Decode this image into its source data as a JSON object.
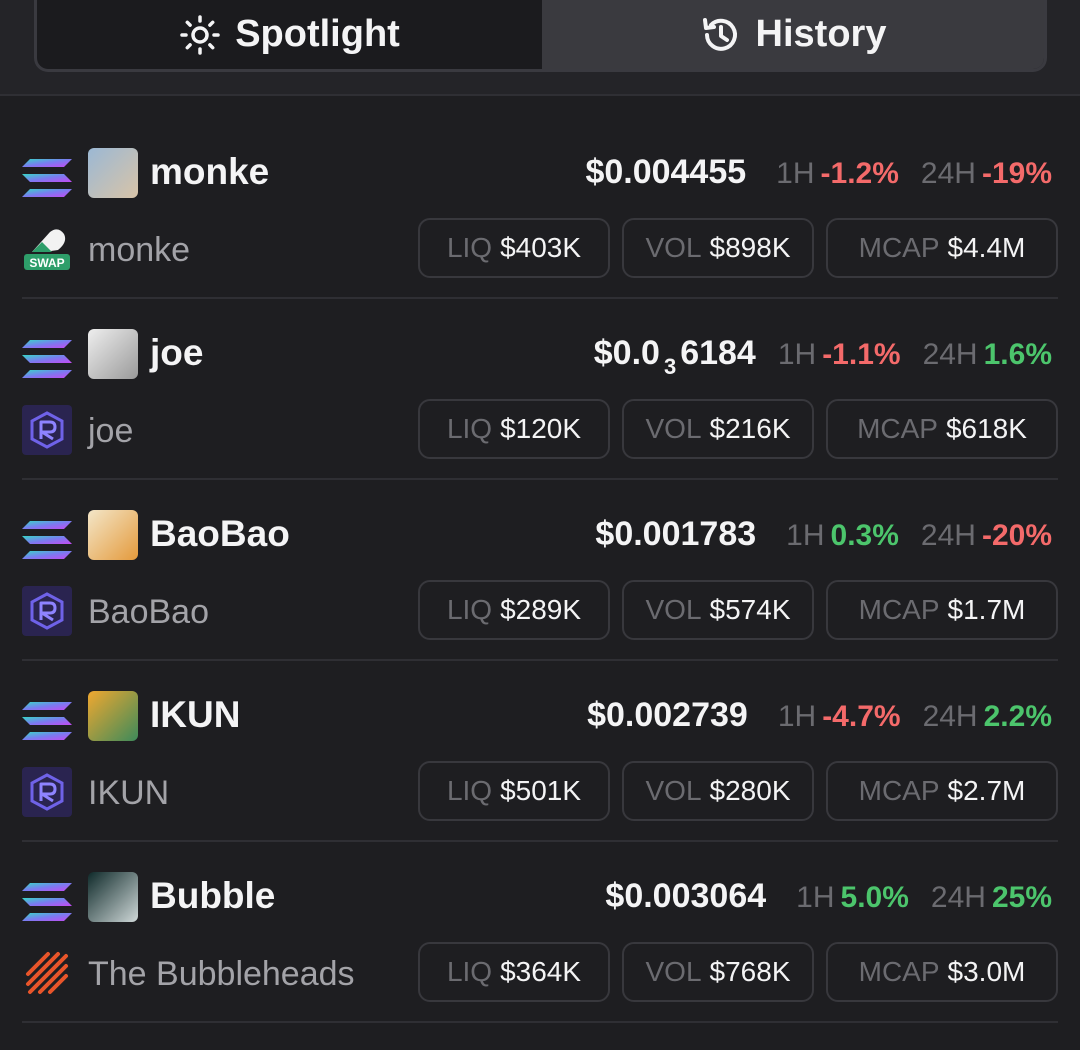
{
  "tabs": [
    {
      "label": "Spotlight",
      "icon": "sun-icon",
      "active": true
    },
    {
      "label": "History",
      "icon": "history-icon",
      "active": false
    }
  ],
  "labels": {
    "h1": "1H",
    "h24": "24H",
    "liq": "LIQ",
    "vol": "VOL",
    "mcap": "MCAP"
  },
  "colors": {
    "negative": "#f46a6a",
    "positive": "#4cc56c",
    "background": "#1e1e21"
  },
  "tokens": [
    {
      "ticker": "monke",
      "name": "monke",
      "dex_icon": "swap-icon",
      "price_prefix": "$0.004455",
      "price_sub": "",
      "price_suffix": "",
      "change_1h": "-1.2%",
      "change_1h_dir": "neg",
      "change_24h": "-19%",
      "change_24h_dir": "neg",
      "liq": "$403K",
      "vol": "$898K",
      "mcap": "$4.4M",
      "avatar_colors": [
        "#9bb8d4",
        "#d8c4a8"
      ]
    },
    {
      "ticker": "joe",
      "name": "joe",
      "dex_icon": "raydium-icon",
      "price_prefix": "$0.0",
      "price_sub": "3",
      "price_suffix": "6184",
      "change_1h": "-1.1%",
      "change_1h_dir": "neg",
      "change_24h": "1.6%",
      "change_24h_dir": "pos",
      "liq": "$120K",
      "vol": "$216K",
      "mcap": "$618K",
      "avatar_colors": [
        "#eeeeee",
        "#9a9a9a"
      ]
    },
    {
      "ticker": "BaoBao",
      "name": "BaoBao",
      "dex_icon": "raydium-icon",
      "price_prefix": "$0.001783",
      "price_sub": "",
      "price_suffix": "",
      "change_1h": "0.3%",
      "change_1h_dir": "pos",
      "change_24h": "-20%",
      "change_24h_dir": "neg",
      "liq": "$289K",
      "vol": "$574K",
      "mcap": "$1.7M",
      "avatar_colors": [
        "#f3e6c8",
        "#e49a3c"
      ]
    },
    {
      "ticker": "IKUN",
      "name": "IKUN",
      "dex_icon": "raydium-icon",
      "price_prefix": "$0.002739",
      "price_sub": "",
      "price_suffix": "",
      "change_1h": "-4.7%",
      "change_1h_dir": "neg",
      "change_24h": "2.2%",
      "change_24h_dir": "pos",
      "liq": "$501K",
      "vol": "$280K",
      "mcap": "$2.7M",
      "avatar_colors": [
        "#f0a830",
        "#3d8a5a"
      ]
    },
    {
      "ticker": "Bubble",
      "name": "The Bubbleheads",
      "dex_icon": "bubble-dex-icon",
      "price_prefix": "$0.003064",
      "price_sub": "",
      "price_suffix": "",
      "change_1h": "5.0%",
      "change_1h_dir": "pos",
      "change_24h": "25%",
      "change_24h_dir": "pos",
      "liq": "$364K",
      "vol": "$768K",
      "mcap": "$3.0M",
      "avatar_colors": [
        "#0f2a2a",
        "#cfd8d8"
      ]
    }
  ]
}
